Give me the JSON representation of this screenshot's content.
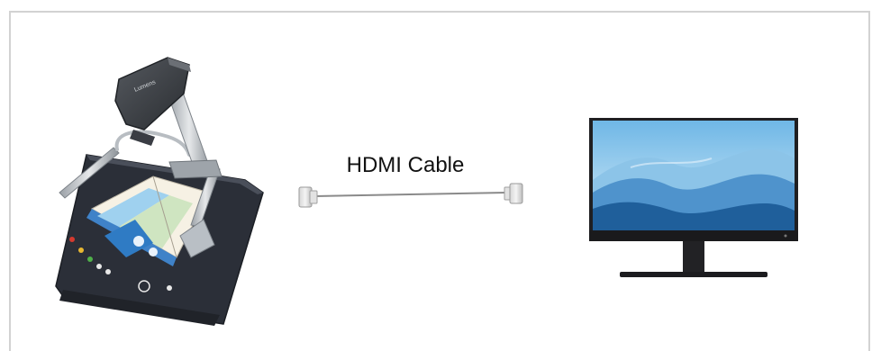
{
  "diagram": {
    "cable_label": "HDMI Cable",
    "left_device_icon": "document-camera-icon",
    "right_device_icon": "monitor-icon",
    "connector_icon": "hdmi-connector-icon",
    "colors": {
      "frame_border": "#d2d2d2",
      "cable": "#8a8a8a",
      "camera_base": "#2b2f38",
      "camera_arm": "#3a3d44",
      "monitor_bezel": "#1f1f22",
      "screen_sky": "#5aa7df",
      "screen_mountain_light": "#9fd0ee",
      "screen_mountain_dark": "#1f5f9b"
    }
  }
}
